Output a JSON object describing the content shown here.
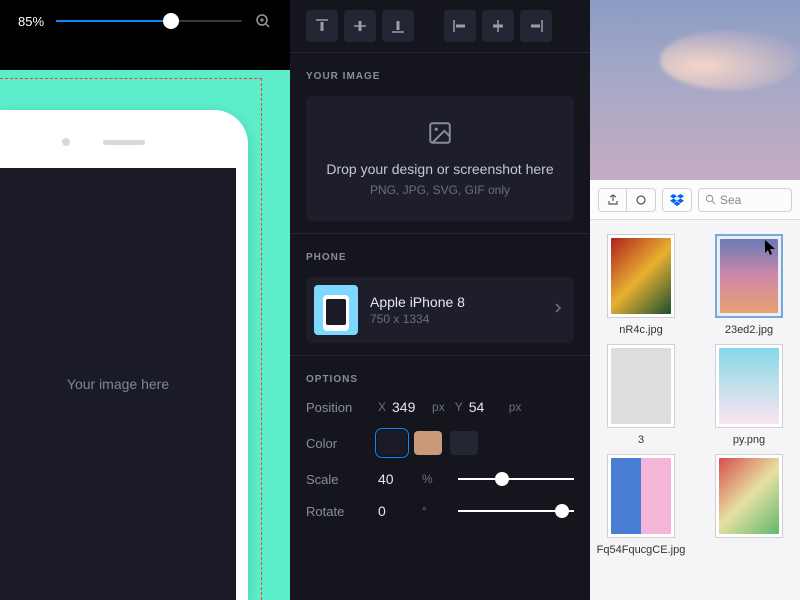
{
  "zoom": {
    "value": "85%",
    "percent": 62
  },
  "canvas": {
    "placeholder": "Your image here"
  },
  "panel": {
    "image_section": "YOUR IMAGE",
    "drop_text": "Drop your design or screenshot here",
    "drop_sub": "PNG, JPG, SVG, GIF only",
    "phone_section": "PHONE",
    "phone_name": "Apple iPhone 8",
    "phone_dims": "750 x 1334",
    "options_section": "OPTIONS",
    "labels": {
      "position": "Position",
      "color": "Color",
      "scale": "Scale",
      "rotate": "Rotate"
    },
    "position": {
      "x": "349",
      "y": "54",
      "unit": "px"
    },
    "colors": {
      "primary": "#1a1b26",
      "secondary": "#c9997a"
    },
    "scale": {
      "value": "40",
      "unit": "%",
      "percent": 38
    },
    "rotate": {
      "value": "0",
      "unit": "°",
      "percent": 90
    }
  },
  "finder": {
    "search_placeholder": "Sea",
    "files": [
      {
        "name": "nR4c.jpg",
        "bg": "linear-gradient(135deg,#b02020,#e8b030,#1a5030)"
      },
      {
        "name": "23ed2.jpg",
        "bg": "linear-gradient(180deg,#6a7ab5 0%,#d088a8 50%,#e8a070 100%)",
        "selected": true
      },
      {
        "name": "3",
        "bg": "#ddd"
      },
      {
        "name": "py.png",
        "bg": "linear-gradient(180deg,#86d9e8,#fce5f0)"
      },
      {
        "name": "Fq54FqucgCE.jpg",
        "bg": "linear-gradient(90deg,#4a7dd4 50%,#f5b5d8 50%)"
      },
      {
        "name": "",
        "bg": "linear-gradient(135deg,#d45050,#e8e0a0,#60b870)"
      }
    ]
  }
}
